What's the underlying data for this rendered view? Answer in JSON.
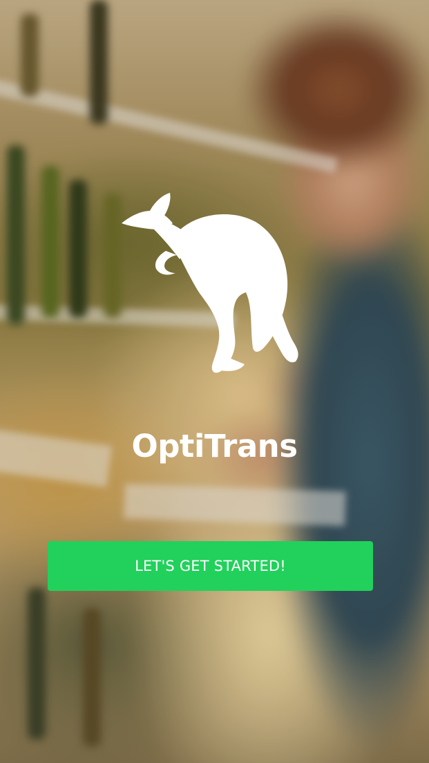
{
  "app": {
    "title": "OptiTrans",
    "logo_icon": "kangaroo-icon"
  },
  "actions": {
    "start_label": "LET'S GET STARTED!"
  },
  "colors": {
    "accent": "#21d15b",
    "text": "#ffffff"
  },
  "background": {
    "description_icon": "supermarket-photo"
  }
}
